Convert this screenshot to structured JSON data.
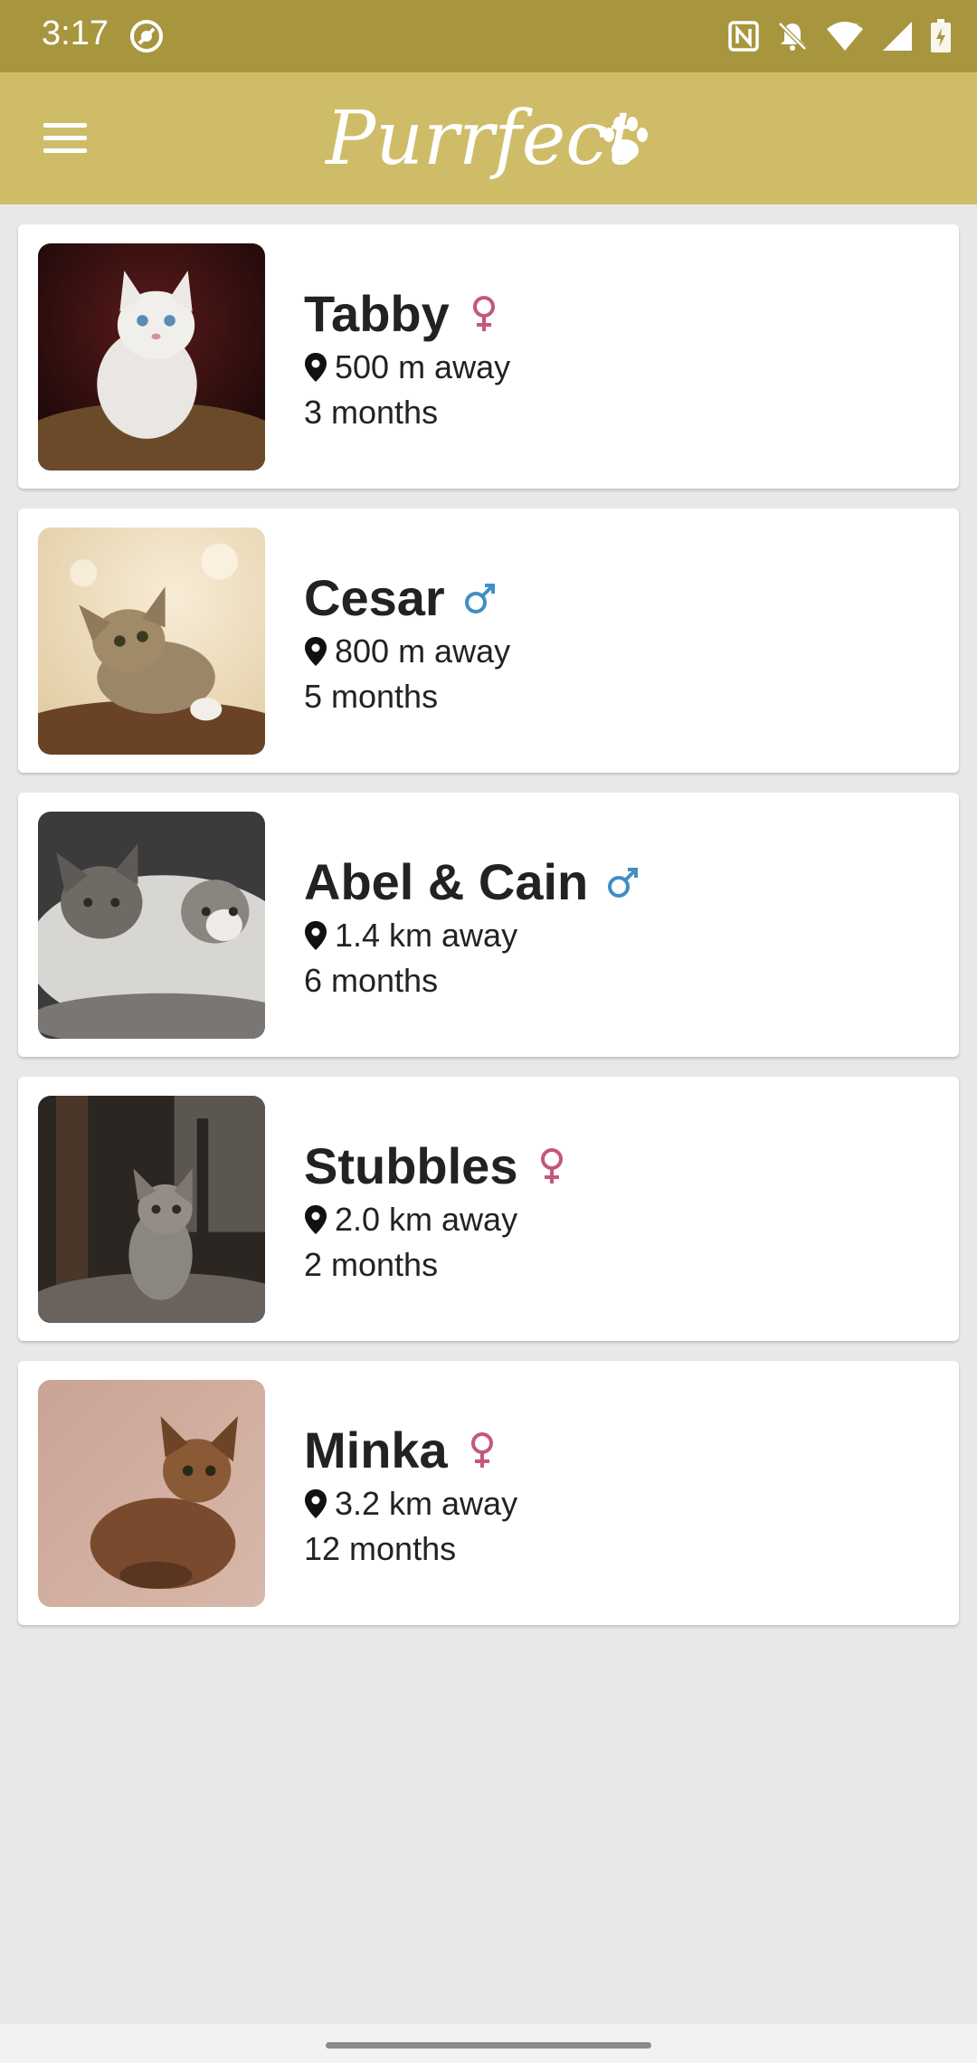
{
  "status_bar": {
    "time": "3:17",
    "icons": [
      "dnd-icon",
      "nfc-icon",
      "mute-icon",
      "wifi-icon",
      "signal-icon",
      "battery-icon"
    ]
  },
  "app_bar": {
    "logo_text": "Purrfect",
    "menu_icon": "hamburger-menu-icon",
    "background": "#cebc68"
  },
  "colors": {
    "female": "#c4587a",
    "male": "#3f8fc4",
    "text": "#222222"
  },
  "cats": [
    {
      "name": "Tabby",
      "gender": "female",
      "distance": "500 m away",
      "age": "3 months"
    },
    {
      "name": "Cesar",
      "gender": "male",
      "distance": "800 m away",
      "age": "5 months"
    },
    {
      "name": "Abel & Cain",
      "gender": "male",
      "distance": "1.4 km away",
      "age": "6 months"
    },
    {
      "name": "Stubbles",
      "gender": "female",
      "distance": "2.0 km away",
      "age": "2 months"
    },
    {
      "name": "Minka",
      "gender": "female",
      "distance": "3.2 km away",
      "age": "12 months"
    }
  ]
}
